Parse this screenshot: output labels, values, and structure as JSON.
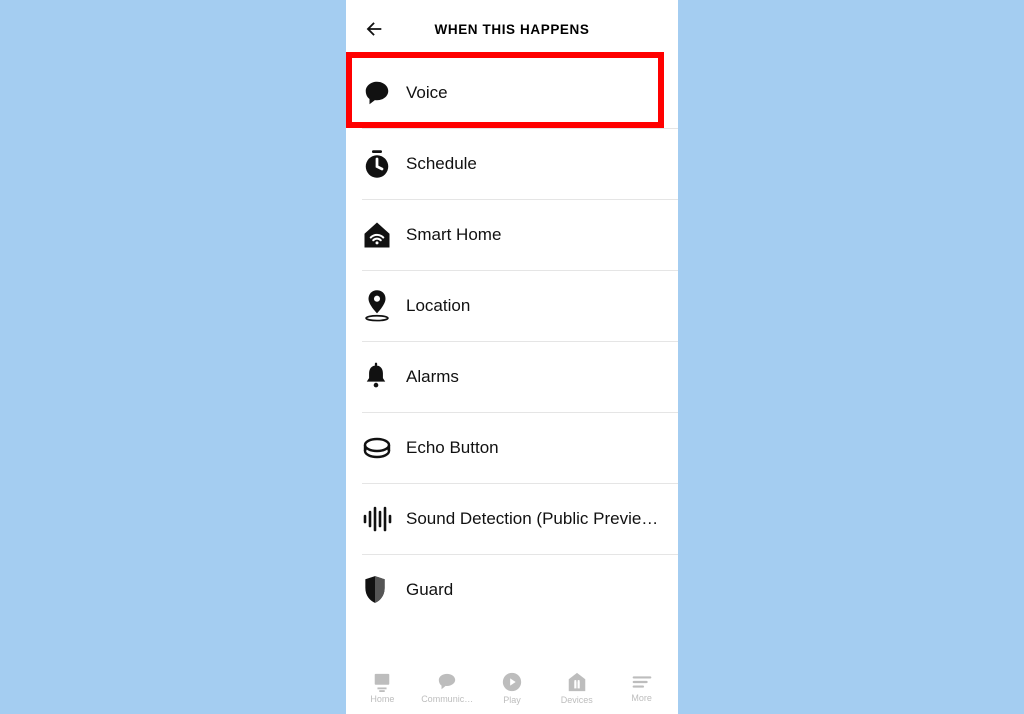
{
  "header": {
    "title": "WHEN THIS HAPPENS"
  },
  "triggers": [
    {
      "id": "voice",
      "label": "Voice",
      "icon": "speech-bubble-icon"
    },
    {
      "id": "schedule",
      "label": "Schedule",
      "icon": "clock-icon"
    },
    {
      "id": "smarthome",
      "label": "Smart Home",
      "icon": "home-wifi-icon"
    },
    {
      "id": "location",
      "label": "Location",
      "icon": "location-pin-icon"
    },
    {
      "id": "alarms",
      "label": "Alarms",
      "icon": "bell-icon"
    },
    {
      "id": "echo",
      "label": "Echo Button",
      "icon": "button-disc-icon"
    },
    {
      "id": "sound",
      "label": "Sound Detection (Public Previe…",
      "icon": "soundwave-icon"
    },
    {
      "id": "guard",
      "label": "Guard",
      "icon": "shield-icon"
    }
  ],
  "highlighted_trigger_index": 0,
  "tabs": [
    {
      "label": "Home",
      "icon": "home-tab-icon"
    },
    {
      "label": "Communic…",
      "icon": "chat-tab-icon"
    },
    {
      "label": "Play",
      "icon": "play-tab-icon"
    },
    {
      "label": "Devices",
      "icon": "devices-tab-icon"
    },
    {
      "label": "More",
      "icon": "more-tab-icon"
    }
  ]
}
